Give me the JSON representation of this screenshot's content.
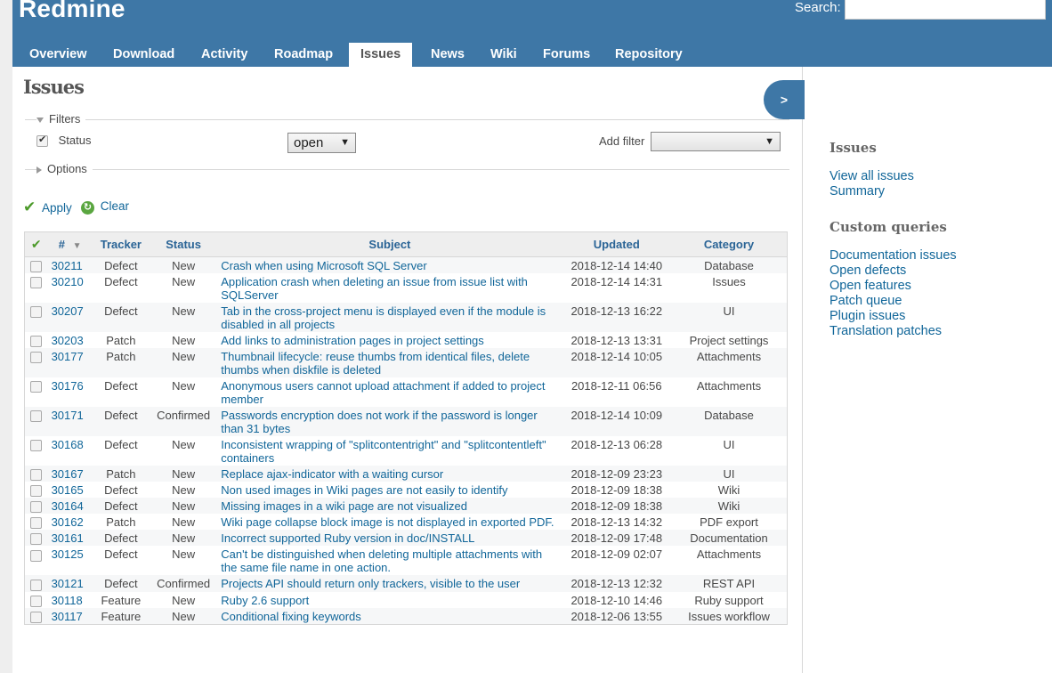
{
  "app": {
    "title": "Redmine",
    "search_label": "Search:",
    "search_value": ""
  },
  "menu": [
    "Overview",
    "Download",
    "Activity",
    "Roadmap",
    "Issues",
    "News",
    "Wiki",
    "Forums",
    "Repository"
  ],
  "page_title": "Issues",
  "filters": {
    "legend": "Filters",
    "status_label": "Status",
    "status_checked": true,
    "status_value": "open",
    "add_filter_label": "Add filter",
    "add_filter_value": ""
  },
  "options_legend": "Options",
  "actions": {
    "apply": "Apply",
    "clear": "Clear"
  },
  "sidebar_toggle": ">",
  "table": {
    "headers": {
      "id": "#",
      "tracker": "Tracker",
      "status": "Status",
      "subject": "Subject",
      "updated": "Updated",
      "category": "Category"
    },
    "rows": [
      {
        "id": "30211",
        "tracker": "Defect",
        "status": "New",
        "subject": "Crash when using Microsoft SQL Server",
        "updated": "2018-12-14 14:40",
        "category": "Database"
      },
      {
        "id": "30210",
        "tracker": "Defect",
        "status": "New",
        "subject": "Application crash when deleting an issue from issue list with SQLServer",
        "updated": "2018-12-14 14:31",
        "category": "Issues"
      },
      {
        "id": "30207",
        "tracker": "Defect",
        "status": "New",
        "subject": "Tab in the cross-project menu is displayed even if the module is disabled in all projects",
        "updated": "2018-12-13 16:22",
        "category": "UI"
      },
      {
        "id": "30203",
        "tracker": "Patch",
        "status": "New",
        "subject": "Add links to administration pages in project settings",
        "updated": "2018-12-13 13:31",
        "category": "Project settings"
      },
      {
        "id": "30177",
        "tracker": "Patch",
        "status": "New",
        "subject": "Thumbnail lifecycle: reuse thumbs from identical files, delete thumbs when diskfile is deleted",
        "updated": "2018-12-14 10:05",
        "category": "Attachments"
      },
      {
        "id": "30176",
        "tracker": "Defect",
        "status": "New",
        "subject": "Anonymous users cannot upload attachment if added to project member",
        "updated": "2018-12-11 06:56",
        "category": "Attachments"
      },
      {
        "id": "30171",
        "tracker": "Defect",
        "status": "Confirmed",
        "subject": "Passwords encryption does not work if the password is longer than 31 bytes",
        "updated": "2018-12-14 10:09",
        "category": "Database"
      },
      {
        "id": "30168",
        "tracker": "Defect",
        "status": "New",
        "subject": "Inconsistent wrapping of \"splitcontentright\" and \"splitcontentleft\" containers",
        "updated": "2018-12-13 06:28",
        "category": "UI"
      },
      {
        "id": "30167",
        "tracker": "Patch",
        "status": "New",
        "subject": "Replace ajax-indicator with a waiting cursor",
        "updated": "2018-12-09 23:23",
        "category": "UI"
      },
      {
        "id": "30165",
        "tracker": "Defect",
        "status": "New",
        "subject": "Non used images in Wiki pages are not easily to identify",
        "updated": "2018-12-09 18:38",
        "category": "Wiki"
      },
      {
        "id": "30164",
        "tracker": "Defect",
        "status": "New",
        "subject": "Missing images in a wiki page are not visualized",
        "updated": "2018-12-09 18:38",
        "category": "Wiki"
      },
      {
        "id": "30162",
        "tracker": "Patch",
        "status": "New",
        "subject": "Wiki page collapse block image is not displayed in exported PDF.",
        "updated": "2018-12-13 14:32",
        "category": "PDF export"
      },
      {
        "id": "30161",
        "tracker": "Defect",
        "status": "New",
        "subject": "Incorrect supported Ruby version in doc/INSTALL",
        "updated": "2018-12-09 17:48",
        "category": "Documentation"
      },
      {
        "id": "30125",
        "tracker": "Defect",
        "status": "New",
        "subject": "Can't be distinguished when deleting multiple attachments with the same file name in one action.",
        "updated": "2018-12-09 02:07",
        "category": "Attachments"
      },
      {
        "id": "30121",
        "tracker": "Defect",
        "status": "Confirmed",
        "subject": "Projects API should return only trackers, visible to the user",
        "updated": "2018-12-13 12:32",
        "category": "REST API"
      },
      {
        "id": "30118",
        "tracker": "Feature",
        "status": "New",
        "subject": "Ruby 2.6 support",
        "updated": "2018-12-10 14:46",
        "category": "Ruby support"
      },
      {
        "id": "30117",
        "tracker": "Feature",
        "status": "New",
        "subject": "Conditional fixing keywords",
        "updated": "2018-12-06 13:55",
        "category": "Issues workflow"
      }
    ]
  },
  "sidebar": {
    "issues_heading": "Issues",
    "issues_links": [
      "View all issues",
      "Summary"
    ],
    "queries_heading": "Custom queries",
    "queries_links": [
      "Documentation issues",
      "Open defects",
      "Open features",
      "Patch queue",
      "Plugin issues",
      "Translation patches"
    ]
  },
  "colors": {
    "header": "#3e77a6",
    "link": "#116699",
    "table_header_bg": "#eeeeee"
  },
  "icons": {
    "apply": "check-icon",
    "clear": "reload-icon"
  }
}
